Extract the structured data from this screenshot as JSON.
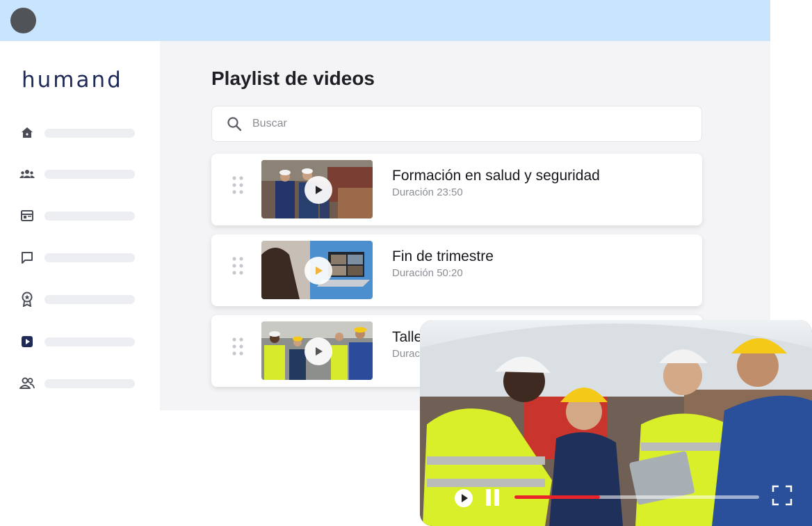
{
  "sidebar": {
    "logo_text": "humand",
    "items": [
      {
        "icon": "home-icon"
      },
      {
        "icon": "groups-icon"
      },
      {
        "icon": "calendar-icon"
      },
      {
        "icon": "chat-icon"
      },
      {
        "icon": "award-icon"
      },
      {
        "icon": "video-play-icon"
      },
      {
        "icon": "people-icon"
      }
    ]
  },
  "main": {
    "title": "Playlist de videos",
    "search": {
      "placeholder": "Buscar"
    },
    "videos": [
      {
        "title": "Formación en salud y seguridad",
        "duration": "Duración 23:50"
      },
      {
        "title": "Fin de trimestre",
        "duration": "Duración 50:20"
      },
      {
        "title": "Taller",
        "duration": "Duración"
      }
    ]
  },
  "player": {
    "progress": 0.35,
    "controls": [
      "play-icon",
      "pause-icon",
      "fullscreen-icon"
    ]
  },
  "colors": {
    "topbar": "#c9e4fd",
    "accent": "#1f2b56",
    "progress": "#e8232a",
    "background": "#f4f4f6"
  }
}
